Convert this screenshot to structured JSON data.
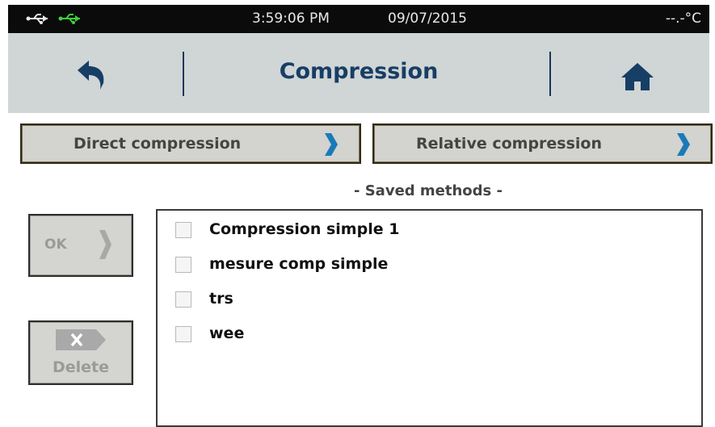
{
  "status_bar": {
    "time": "3:59:06 PM",
    "date": "09/07/2015",
    "temperature": "--.-°C",
    "icons": [
      "usb-icon",
      "usb-connected-icon"
    ]
  },
  "header": {
    "title": "Compression",
    "back_icon": "back-arrow-icon",
    "home_icon": "home-icon",
    "accent_color": "#173e64"
  },
  "mode_buttons": {
    "direct": "Direct compression",
    "relative": "Relative compression",
    "chevron_color": "#1a7ab8"
  },
  "saved_methods": {
    "title": "- Saved methods -",
    "items": [
      {
        "name": "Compression simple 1",
        "checked": false
      },
      {
        "name": "mesure comp simple",
        "checked": false
      },
      {
        "name": "trs",
        "checked": false
      },
      {
        "name": "wee",
        "checked": false
      }
    ]
  },
  "actions": {
    "ok": "OK",
    "delete": "Delete",
    "ok_enabled": false,
    "delete_enabled": false
  }
}
